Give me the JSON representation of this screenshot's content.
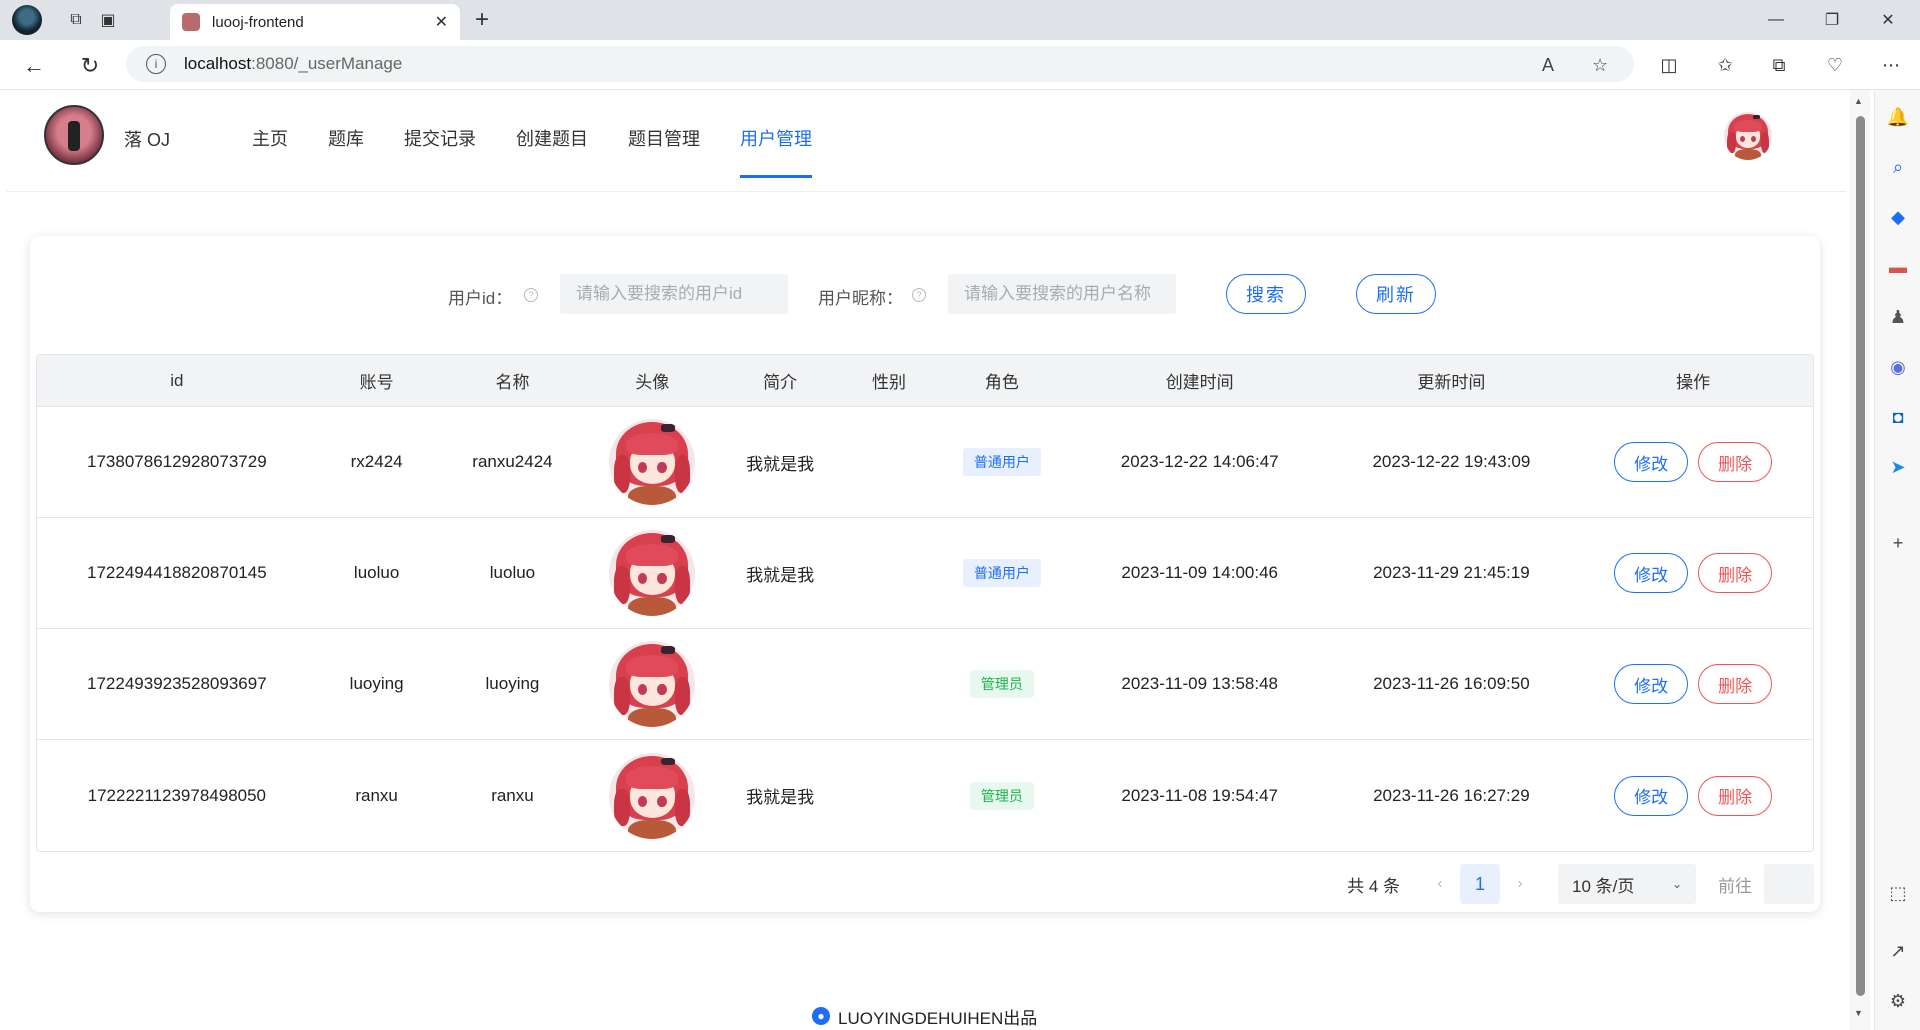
{
  "browser": {
    "tab_title": "luooj-frontend",
    "url_host": "localhost",
    "url_path": ":8080/_userManage"
  },
  "header": {
    "app_name": "落 OJ",
    "menu": [
      {
        "label": "主页",
        "active": false
      },
      {
        "label": "题库",
        "active": false
      },
      {
        "label": "提交记录",
        "active": false
      },
      {
        "label": "创建题目",
        "active": false
      },
      {
        "label": "题目管理",
        "active": false
      },
      {
        "label": "用户管理",
        "active": true
      }
    ]
  },
  "search": {
    "user_id_label": "用户id：",
    "user_id_placeholder": "请输入要搜索的用户id",
    "nickname_label": "用户昵称：",
    "nickname_placeholder": "请输入要搜索的用户名称",
    "search_button": "搜索",
    "refresh_button": "刷新"
  },
  "table": {
    "columns": [
      "id",
      "账号",
      "名称",
      "头像",
      "简介",
      "性别",
      "角色",
      "创建时间",
      "更新时间",
      "操作"
    ],
    "rows": [
      {
        "id": "1738078612928073729",
        "account": "rx2424",
        "name": "ranxu2424",
        "intro": "我就是我",
        "gender": "",
        "role": "普通用户",
        "role_type": "user",
        "created": "2023-12-22 14:06:47",
        "updated": "2023-12-22 19:43:09"
      },
      {
        "id": "1722494418820870145",
        "account": "luoluo",
        "name": "luoluo",
        "intro": "我就是我",
        "gender": "",
        "role": "普通用户",
        "role_type": "user",
        "created": "2023-11-09 14:00:46",
        "updated": "2023-11-29 21:45:19"
      },
      {
        "id": "1722493923528093697",
        "account": "luoying",
        "name": "luoying",
        "intro": "",
        "gender": "",
        "role": "管理员",
        "role_type": "admin",
        "created": "2023-11-09 13:58:48",
        "updated": "2023-11-26 16:09:50"
      },
      {
        "id": "1722221123978498050",
        "account": "ranxu",
        "name": "ranxu",
        "intro": "我就是我",
        "gender": "",
        "role": "管理员",
        "role_type": "admin",
        "created": "2023-11-08 19:54:47",
        "updated": "2023-11-26 16:27:29"
      }
    ],
    "edit_label": "修改",
    "delete_label": "删除"
  },
  "pagination": {
    "total_text": "共 4 条",
    "current_page": "1",
    "page_size": "10 条/页",
    "goto_label": "前往"
  },
  "footer": {
    "text": "LUOYINGDEHUIHEN出品"
  },
  "colors": {
    "primary": "#1e6ef5",
    "danger": "#f15555",
    "success": "#1fb44a"
  }
}
